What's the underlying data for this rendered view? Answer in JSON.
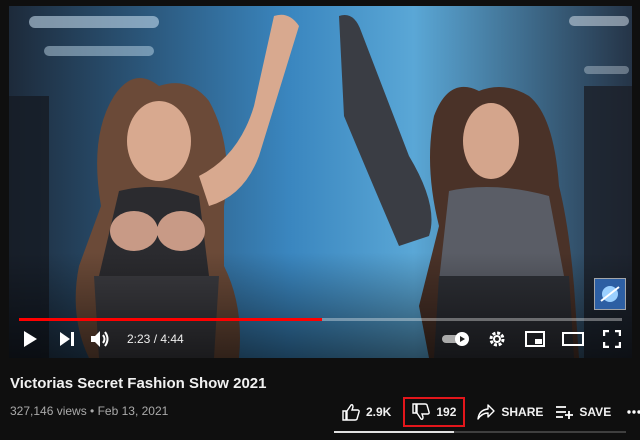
{
  "player": {
    "current_time": "2:23",
    "duration": "4:44",
    "time_separator": " / ",
    "progress_fraction": 0.503,
    "accent_color": "#ff0000"
  },
  "video": {
    "title": "Victorias Secret Fashion Show 2021",
    "views": "327,146 views",
    "meta_separator": " • ",
    "date": "Feb 13, 2021"
  },
  "actions": {
    "like_count": "2.9K",
    "dislike_count": "192",
    "share_label": "SHARE",
    "save_label": "SAVE",
    "more_icon": "ellipsis-icon"
  },
  "colors": {
    "highlight": "#e3161b",
    "background": "#0f0f0f"
  }
}
